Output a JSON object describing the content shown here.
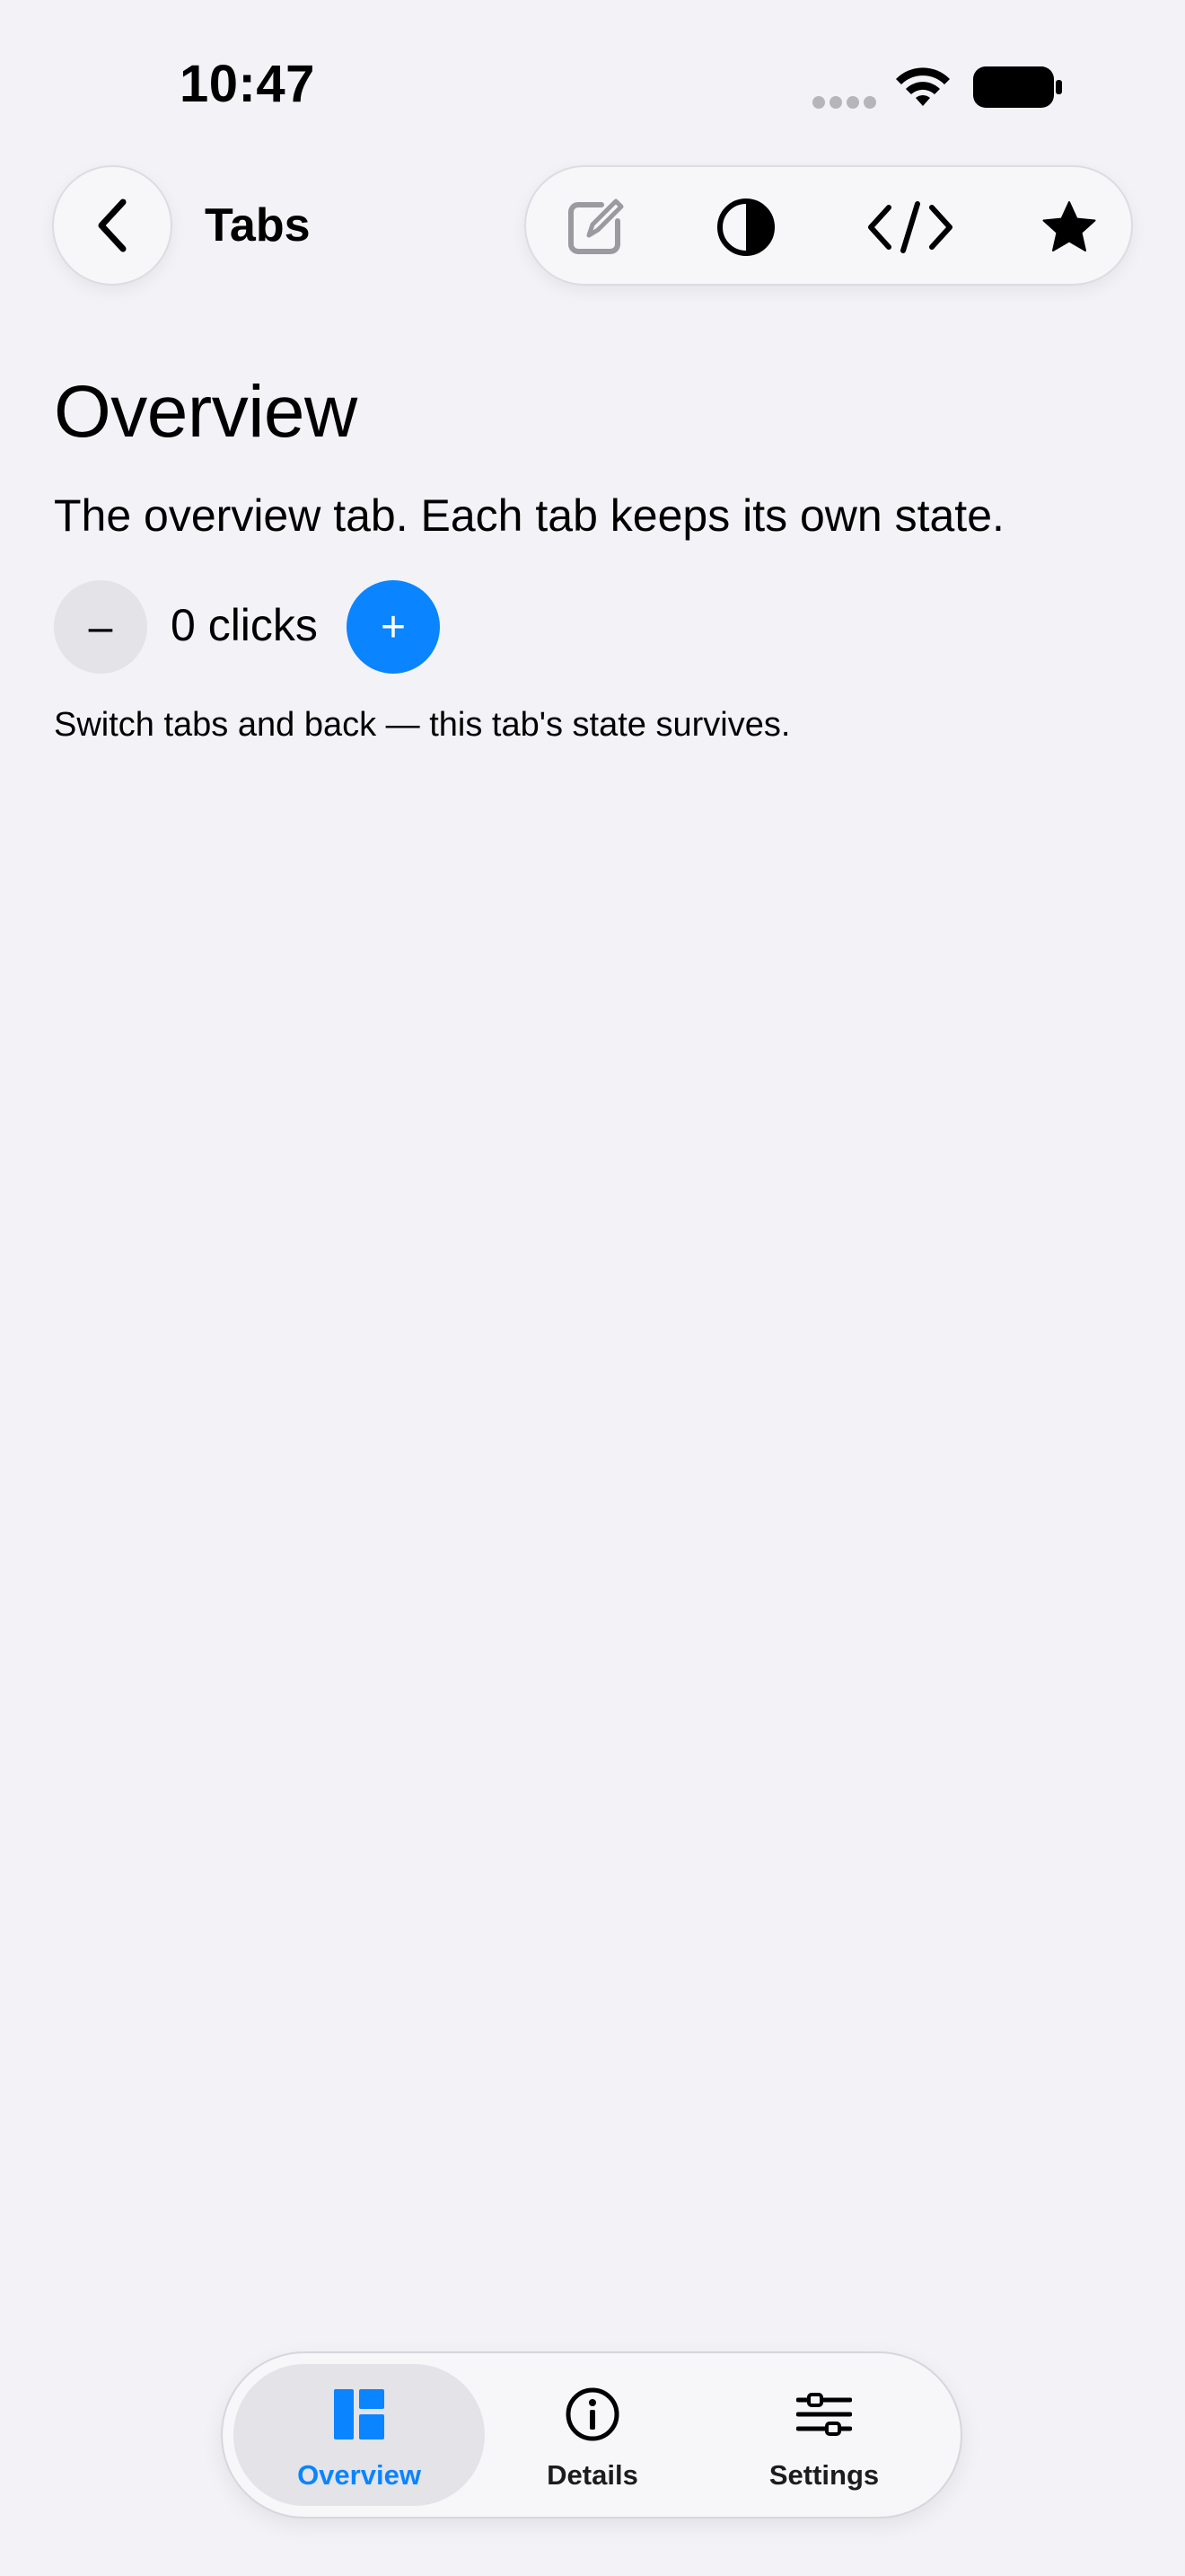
{
  "status_bar": {
    "time": "10:47"
  },
  "nav": {
    "title": "Tabs",
    "toolbar_icons": [
      "compose-icon",
      "contrast-icon",
      "code-icon",
      "star-icon"
    ]
  },
  "content": {
    "title": "Overview",
    "description": "The overview tab. Each tab keeps its own state.",
    "counter": {
      "minus_label": "–",
      "value_text": "0 clicks",
      "plus_label": "+"
    },
    "hint": "Switch tabs and back — this tab's state survives."
  },
  "tabbar": {
    "tabs": [
      {
        "label": "Overview",
        "icon": "overview-icon",
        "selected": true
      },
      {
        "label": "Details",
        "icon": "info-icon",
        "selected": false
      },
      {
        "label": "Settings",
        "icon": "sliders-icon",
        "selected": false
      }
    ]
  },
  "colors": {
    "accent": "#0a84ff",
    "background": "#f2f2f7"
  }
}
